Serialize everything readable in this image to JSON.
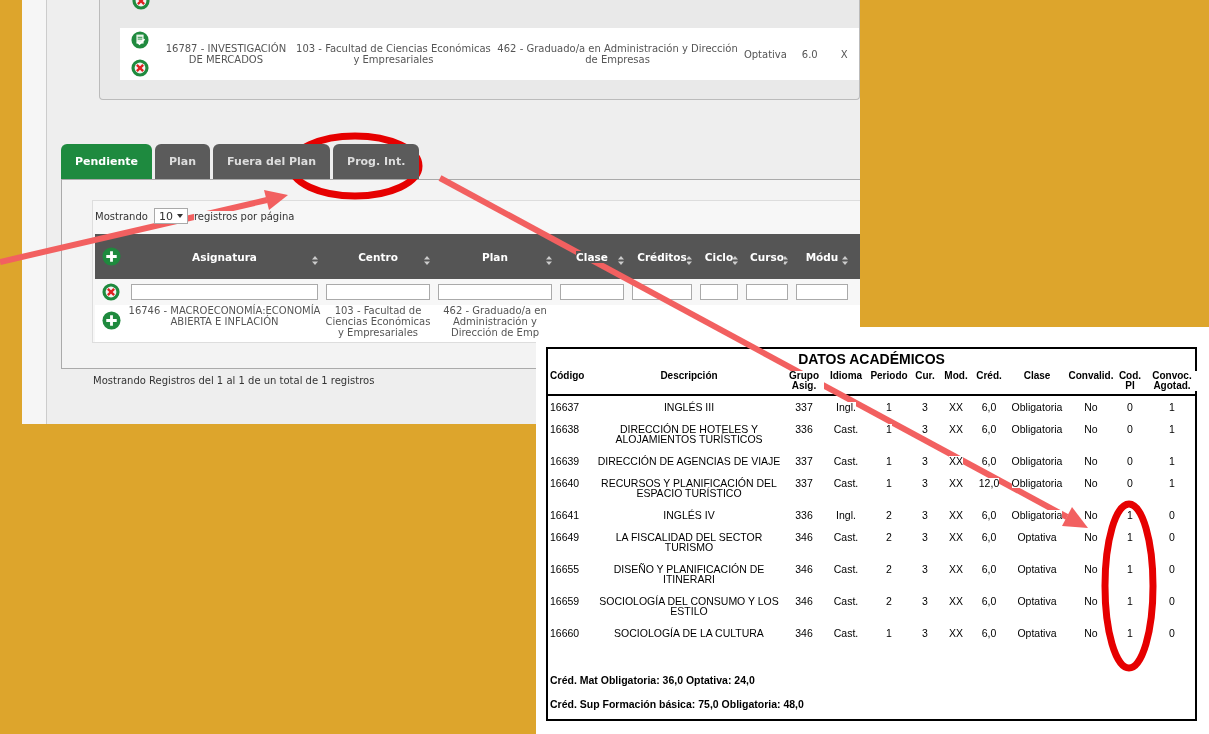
{
  "background_window": {
    "subject_row": {
      "cells": [
        "16787 - INVESTIGACIÓN DE MERCADOS",
        "103 - Facultad de Ciencias Económicas y Empresariales",
        "462 - Graduado/a en Administración y Dirección de Empresas",
        "Optativa",
        "6.0",
        "X"
      ]
    },
    "tabs": [
      {
        "label": "Pendiente",
        "selected": true
      },
      {
        "label": "Plan",
        "selected": false
      },
      {
        "label": "Fuera del Plan",
        "selected": false
      },
      {
        "label": "Prog. Int.",
        "selected": false
      }
    ],
    "page_length": {
      "label": "Mostrando",
      "value": "10",
      "suffix": "registros por página"
    },
    "table": {
      "columns": [
        "Asignatura",
        "Centro",
        "Plan",
        "Clase",
        "Créditos",
        "Ciclo",
        "Curso",
        "Módu"
      ],
      "rows": [
        {
          "cells": [
            "16746 - MACROECONOMÍA:ECONOMÍA ABIERTA E INFLACIÓN",
            "103 - Facultad de Ciencias Económicas y Empresariales",
            "462 - Graduado/a en Administración y Dirección de Emp"
          ]
        }
      ]
    },
    "info": "Mostrando Registros del 1 al 1 de un total de 1 registros"
  },
  "document": {
    "title": "DATOS ACADÉMICOS",
    "columns": [
      "Código",
      "Descripción",
      "Grupo Asig.",
      "Idioma",
      "Periodo",
      "Cur.",
      "Mod.",
      "Créd.",
      "Clase",
      "Convalid.",
      "Cod. PI",
      "Convoc. Agotad."
    ],
    "rows": [
      {
        "cells": [
          "16637",
          "INGLÉS III",
          "337",
          "Ingl.",
          "1",
          "3",
          "XX",
          "6,0",
          "Obligatoria",
          "No",
          "0",
          "1"
        ]
      },
      {
        "cells": [
          "16638",
          "DIRECCIÓN DE HOTELES Y ALOJAMIENTOS TURÍSTICOS",
          "336",
          "Cast.",
          "1",
          "3",
          "XX",
          "6,0",
          "Obligatoria",
          "No",
          "0",
          "1"
        ]
      },
      {
        "cells": [
          "16639",
          "DIRECCIÓN DE AGENCIAS DE VIAJE",
          "337",
          "Cast.",
          "1",
          "3",
          "XX",
          "6,0",
          "Obligatoria",
          "No",
          "0",
          "1"
        ]
      },
      {
        "cells": [
          "16640",
          "RECURSOS Y PLANIFICACIÓN DEL ESPACIO TURÍSTICO",
          "337",
          "Cast.",
          "1",
          "3",
          "XX",
          "12,0",
          "Obligatoria",
          "No",
          "0",
          "1"
        ]
      },
      {
        "cells": [
          "16641",
          "INGLÉS IV",
          "336",
          "Ingl.",
          "2",
          "3",
          "XX",
          "6,0",
          "Obligatoria",
          "No",
          "1",
          "0"
        ]
      },
      {
        "cells": [
          "16649",
          "LA FISCALIDAD DEL SECTOR TURISMO",
          "346",
          "Cast.",
          "2",
          "3",
          "XX",
          "6,0",
          "Optativa",
          "No",
          "1",
          "0"
        ]
      },
      {
        "cells": [
          "16655",
          "DISEÑO Y PLANIFICACIÓN DE ITINERARI",
          "346",
          "Cast.",
          "2",
          "3",
          "XX",
          "6,0",
          "Optativa",
          "No",
          "1",
          "0"
        ]
      },
      {
        "cells": [
          "16659",
          "SOCIOLOGÍA DEL CONSUMO Y LOS ESTILO",
          "346",
          "Cast.",
          "2",
          "3",
          "XX",
          "6,0",
          "Optativa",
          "No",
          "1",
          "0"
        ]
      },
      {
        "cells": [
          "16660",
          "SOCIOLOGÍA DE LA CULTURA",
          "346",
          "Cast.",
          "1",
          "3",
          "XX",
          "6,0",
          "Optativa",
          "No",
          "1",
          "0"
        ]
      }
    ],
    "summary": [
      "Créd. Mat Obligatoria: 36,0 Optativa: 24,0",
      "Créd. Sup Formación básica: 75,0 Obligatoria: 48,0"
    ]
  }
}
